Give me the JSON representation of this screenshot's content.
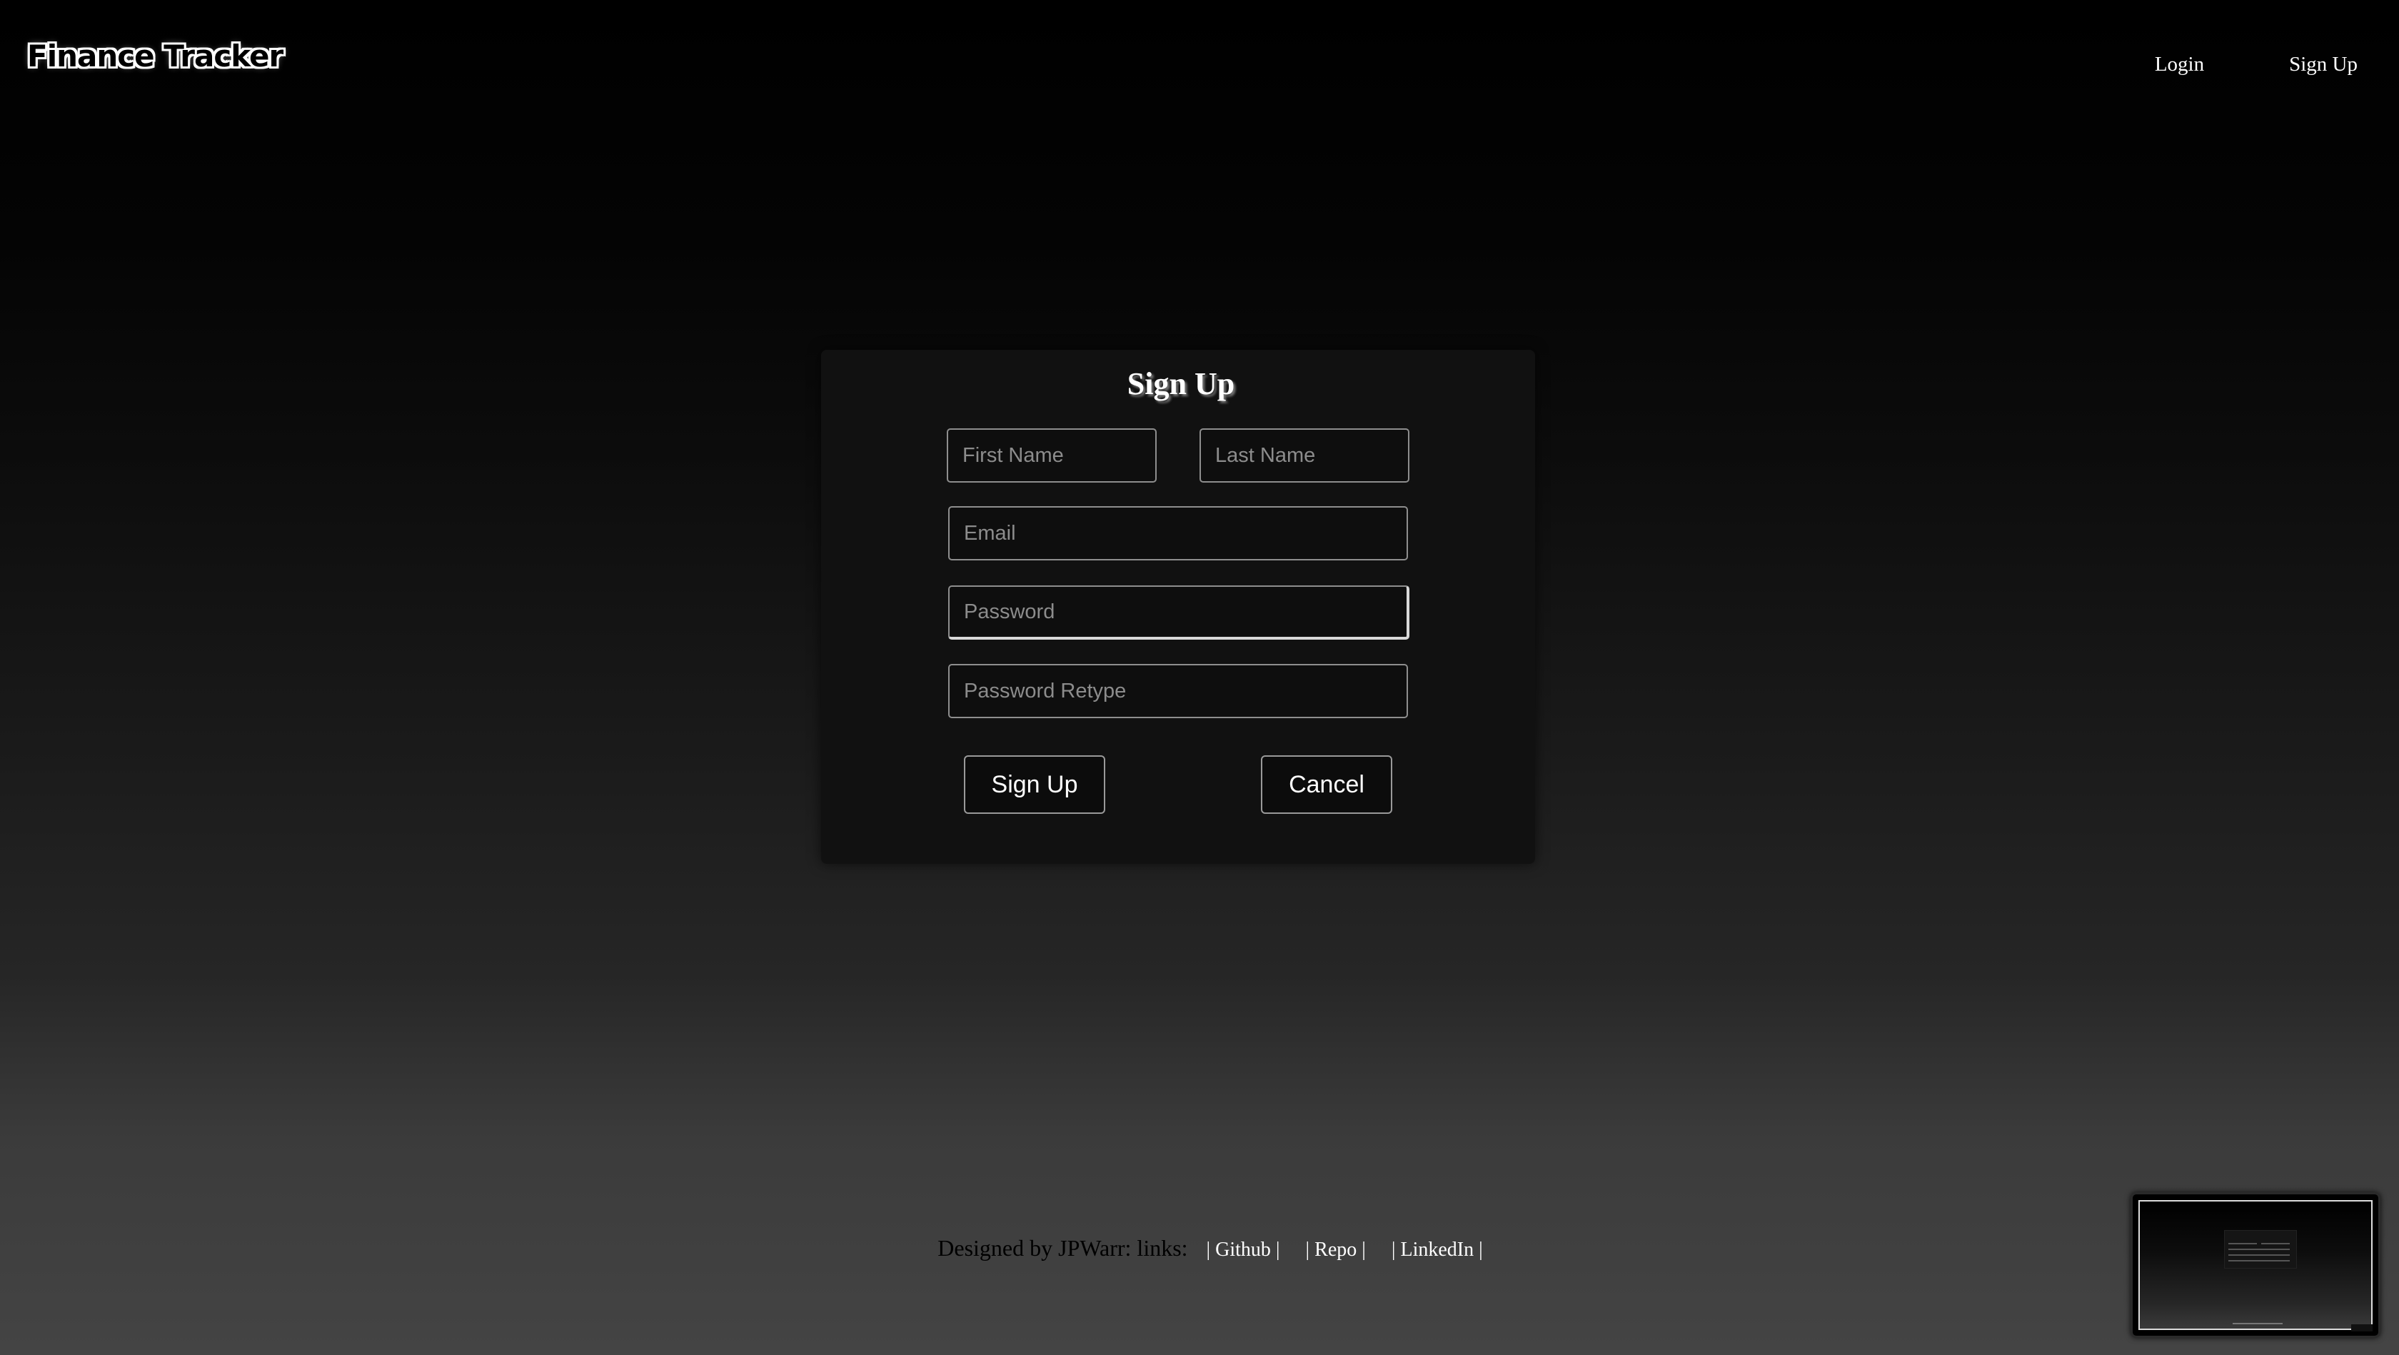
{
  "header": {
    "brand": "Finance Tracker",
    "nav": {
      "login": "Login",
      "signup": "Sign Up"
    }
  },
  "form": {
    "title": "Sign Up",
    "fields": {
      "first_name": {
        "placeholder": "First Name",
        "value": ""
      },
      "last_name": {
        "placeholder": "Last Name",
        "value": ""
      },
      "email": {
        "placeholder": "Email",
        "value": ""
      },
      "password": {
        "placeholder": "Password",
        "value": ""
      },
      "password_retype": {
        "placeholder": "Password Retype",
        "value": ""
      }
    },
    "buttons": {
      "submit": "Sign Up",
      "cancel": "Cancel"
    }
  },
  "footer": {
    "text": "Designed by JPWarr: links:",
    "links": {
      "github": "| Github |",
      "repo": "| Repo |",
      "linkedin": "| LinkedIn |"
    }
  },
  "colors": {
    "text": "#ffffff",
    "card_background": "#111111",
    "field_border": "#8e8e8e",
    "footer_text": "#000000"
  }
}
